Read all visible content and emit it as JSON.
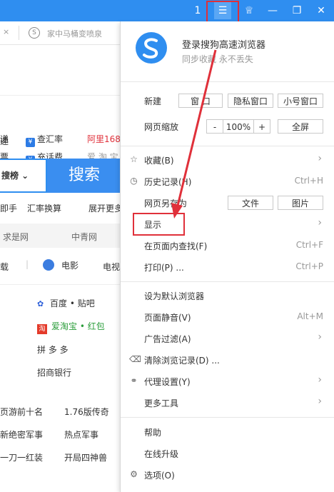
{
  "titlebar": {
    "buttons": [
      {
        "name": "sidebar-toggle-icon",
        "glyph": "1"
      },
      {
        "name": "menu-icon",
        "glyph": "☰"
      },
      {
        "name": "skin-icon",
        "glyph": "♕"
      },
      {
        "name": "minimize-icon",
        "glyph": "—"
      },
      {
        "name": "restore-icon",
        "glyph": "❐"
      },
      {
        "name": "close-icon",
        "glyph": "✕"
      }
    ]
  },
  "background": {
    "address_hint": "家中马桶变喷泉",
    "row1": [
      "递",
      "查汇率",
      "阿里168"
    ],
    "row2": [
      "票",
      "充话费",
      "爱 淘 宝"
    ],
    "search_dropdown": "搜榜 ⌄",
    "search_button": "搜索",
    "links1": [
      "即手",
      "汇率换算",
      "展开更多"
    ],
    "tabs": [
      "求是网",
      "中青网"
    ],
    "media": [
      "载",
      "电影",
      "电视"
    ],
    "sites": [
      "百度 • 贴吧",
      "爱淘宝 • 红包",
      "拼 多 多",
      "招商银行"
    ],
    "news": [
      "页游前十名",
      "1.76版传奇",
      "新绝密军事",
      "热点军事",
      "一刀一红装",
      "开局四神兽"
    ]
  },
  "menu": {
    "login_title": "登录搜狗高速浏览器",
    "login_sub": "同步收藏 永不丢失",
    "new_label": "新建",
    "new_buttons": [
      "窗 口",
      "隐私窗口",
      "小号窗口"
    ],
    "zoom_label": "网页缩放",
    "zoom_minus": "-",
    "zoom_value": "100%",
    "zoom_plus": "+",
    "fullscreen": "全屏",
    "favorites": "收藏(B)",
    "history": "历史记录(H)",
    "history_shortcut": "Ctrl+H",
    "save_as": "网页另存为",
    "save_file": "文件",
    "save_image": "图片",
    "display": "显示",
    "find": "在页面内查找(F)",
    "find_shortcut": "Ctrl+F",
    "print": "打印(P) ...",
    "print_shortcut": "Ctrl+P",
    "default_browser": "设为默认浏览器",
    "mute": "页面静音(V)",
    "mute_shortcut": "Alt+M",
    "adblock": "广告过滤(A)",
    "clear": "清除浏览记录(D) ...",
    "proxy": "代理设置(Y)",
    "more_tools": "更多工具",
    "help": "帮助",
    "upgrade": "在线升级",
    "options": "选项(O)"
  },
  "colors": {
    "titlebar": "#2f8ef0",
    "annotation": "#e0303a",
    "search": "#3a8ef0"
  }
}
